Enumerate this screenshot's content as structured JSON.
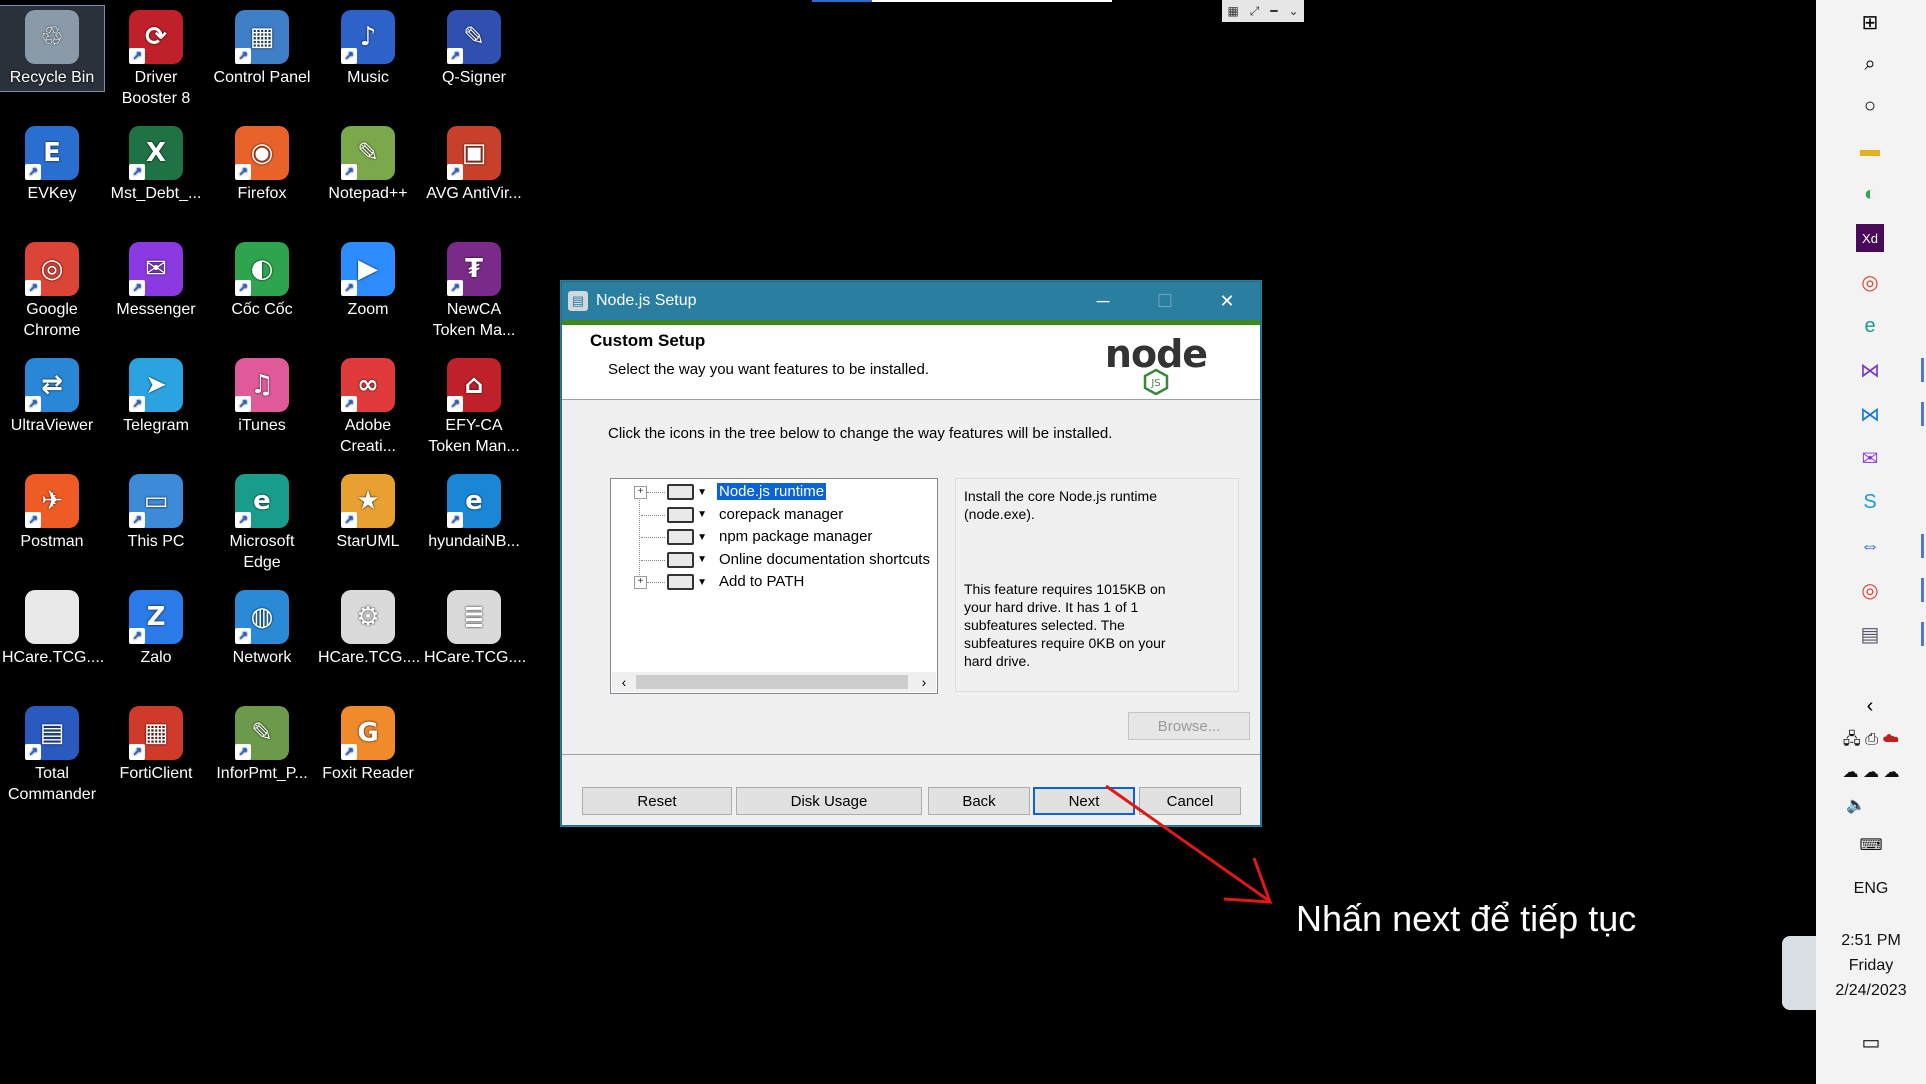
{
  "desktop": {
    "icons": [
      {
        "label": "Recycle Bin",
        "icon": "recycle-bin-icon",
        "color": "#8a9aa8",
        "glyph": "♲",
        "selected": true
      },
      {
        "label": "Driver Booster 8",
        "icon": "driver-booster-icon",
        "color": "#c0202a",
        "glyph": "⟳"
      },
      {
        "label": "Control Panel",
        "icon": "control-panel-icon",
        "color": "#3f7fc8",
        "glyph": "▦"
      },
      {
        "label": "Music",
        "icon": "music-icon",
        "color": "#2d63c8",
        "glyph": "♪"
      },
      {
        "label": "Q-Signer",
        "icon": "q-signer-icon",
        "color": "#3050b0",
        "glyph": "✎"
      },
      {
        "label": "EVKey",
        "icon": "evkey-icon",
        "color": "#2a6fd0",
        "glyph": "E"
      },
      {
        "label": "Mst_Debt_...",
        "icon": "excel-file-icon",
        "color": "#1f7244",
        "glyph": "X"
      },
      {
        "label": "Firefox",
        "icon": "firefox-icon",
        "color": "#e8622a",
        "glyph": "◉"
      },
      {
        "label": "Notepad++",
        "icon": "notepad-plus-plus-icon",
        "color": "#7aa84a",
        "glyph": "✎"
      },
      {
        "label": "AVG AntiVir...",
        "icon": "avg-antivirus-icon",
        "color": "#c8402a",
        "glyph": "▣"
      },
      {
        "label": "Google Chrome",
        "icon": "chrome-icon",
        "color": "#db4437",
        "glyph": "◎"
      },
      {
        "label": "Messenger",
        "icon": "messenger-icon",
        "color": "#8a3ae0",
        "glyph": "✉"
      },
      {
        "label": "Cốc Cốc",
        "icon": "coc-coc-icon",
        "color": "#2ea44f",
        "glyph": "◐"
      },
      {
        "label": "Zoom",
        "icon": "zoom-icon",
        "color": "#2d8cff",
        "glyph": "▶"
      },
      {
        "label": "NewCA Token Ma...",
        "icon": "newca-token-icon",
        "color": "#7a2a8a",
        "glyph": "₮"
      },
      {
        "label": "UltraViewer",
        "icon": "ultraviewer-icon",
        "color": "#2a86d6",
        "glyph": "⇄"
      },
      {
        "label": "Telegram",
        "icon": "telegram-icon",
        "color": "#2aa3e0",
        "glyph": "➤"
      },
      {
        "label": "iTunes",
        "icon": "itunes-icon",
        "color": "#e05a9a",
        "glyph": "♫"
      },
      {
        "label": "Adobe Creati...",
        "icon": "adobe-creative-cloud-icon",
        "color": "#e03a3a",
        "glyph": "∞"
      },
      {
        "label": "EFY-CA Token Man...",
        "icon": "efy-ca-token-icon",
        "color": "#c0202a",
        "glyph": "⌂"
      },
      {
        "label": "Postman",
        "icon": "postman-icon",
        "color": "#ef5b25",
        "glyph": "✈"
      },
      {
        "label": "This PC",
        "icon": "this-pc-icon",
        "color": "#3c8ad8",
        "glyph": "▭"
      },
      {
        "label": "Microsoft Edge",
        "icon": "edge-icon",
        "color": "#1a9c8c",
        "glyph": "e"
      },
      {
        "label": "StarUML",
        "icon": "staruml-icon",
        "color": "#e8a030",
        "glyph": "★"
      },
      {
        "label": "hyundaiNB...",
        "icon": "edge-shortcut-icon",
        "color": "#1a86d6",
        "glyph": "e"
      },
      {
        "label": "HCare.TCG....",
        "icon": "file-icon",
        "color": "#e8e8e8",
        "glyph": ""
      },
      {
        "label": "Zalo",
        "icon": "zalo-icon",
        "color": "#2a7ae8",
        "glyph": "Z"
      },
      {
        "label": "Network",
        "icon": "network-icon",
        "color": "#2a8ad6",
        "glyph": "◍"
      },
      {
        "label": "HCare.TCG....",
        "icon": "config-file-icon",
        "color": "#dadada",
        "glyph": "⚙"
      },
      {
        "label": "HCare.TCG....",
        "icon": "script-file-icon",
        "color": "#dadada",
        "glyph": "≣"
      },
      {
        "label": "Total Commander",
        "icon": "total-commander-icon",
        "color": "#2a5ac0",
        "glyph": "▤"
      },
      {
        "label": "FortiClient",
        "icon": "forticlient-icon",
        "color": "#d03a2a",
        "glyph": "▦"
      },
      {
        "label": "InforPmt_P...",
        "icon": "notepad-file-icon",
        "color": "#6a9a4a",
        "glyph": "✎"
      },
      {
        "label": "Foxit Reader",
        "icon": "foxit-reader-icon",
        "color": "#f08a2a",
        "glyph": "G"
      }
    ]
  },
  "dialog": {
    "title": "Node.js Setup",
    "minimize_glyph": "─",
    "maximize_glyph": "☐",
    "close_glyph": "✕",
    "banner_title": "Custom Setup",
    "banner_subtitle": "Select the way you want features to be installed.",
    "logo_text": "node",
    "logo_badge": "JS",
    "instruction": "Click the icons in the tree below to change the way features will be installed.",
    "tree": [
      {
        "label": "Node.js runtime",
        "expandable": true,
        "selected": true
      },
      {
        "label": "corepack manager",
        "expandable": false,
        "selected": false
      },
      {
        "label": "npm package manager",
        "expandable": false,
        "selected": false
      },
      {
        "label": "Online documentation shortcuts",
        "expandable": false,
        "selected": false
      },
      {
        "label": "Add to PATH",
        "expandable": true,
        "selected": false
      }
    ],
    "description_line1": "Install the core Node.js runtime (node.exe).",
    "description_line2": "This feature requires 1015KB on your hard drive. It has 1 of 1 subfeatures selected. The subfeatures require 0KB on your hard drive.",
    "browse_label": "Browse...",
    "buttons": {
      "reset": "Reset",
      "disk_usage": "Disk Usage",
      "back": "Back",
      "next": "Next",
      "cancel": "Cancel"
    }
  },
  "annotation": {
    "text": "Nhấn next để tiếp tục",
    "arrow_color": "#e01818"
  },
  "taskbar": {
    "language": "ENG",
    "time": "2:51 PM",
    "day": "Friday",
    "date": "2/24/2023"
  },
  "colors": {
    "titlebar": "#2a7ea0",
    "banner_stripe": "#3f8a1f",
    "selection": "#0a64d4",
    "node_green": "#3c873a"
  }
}
